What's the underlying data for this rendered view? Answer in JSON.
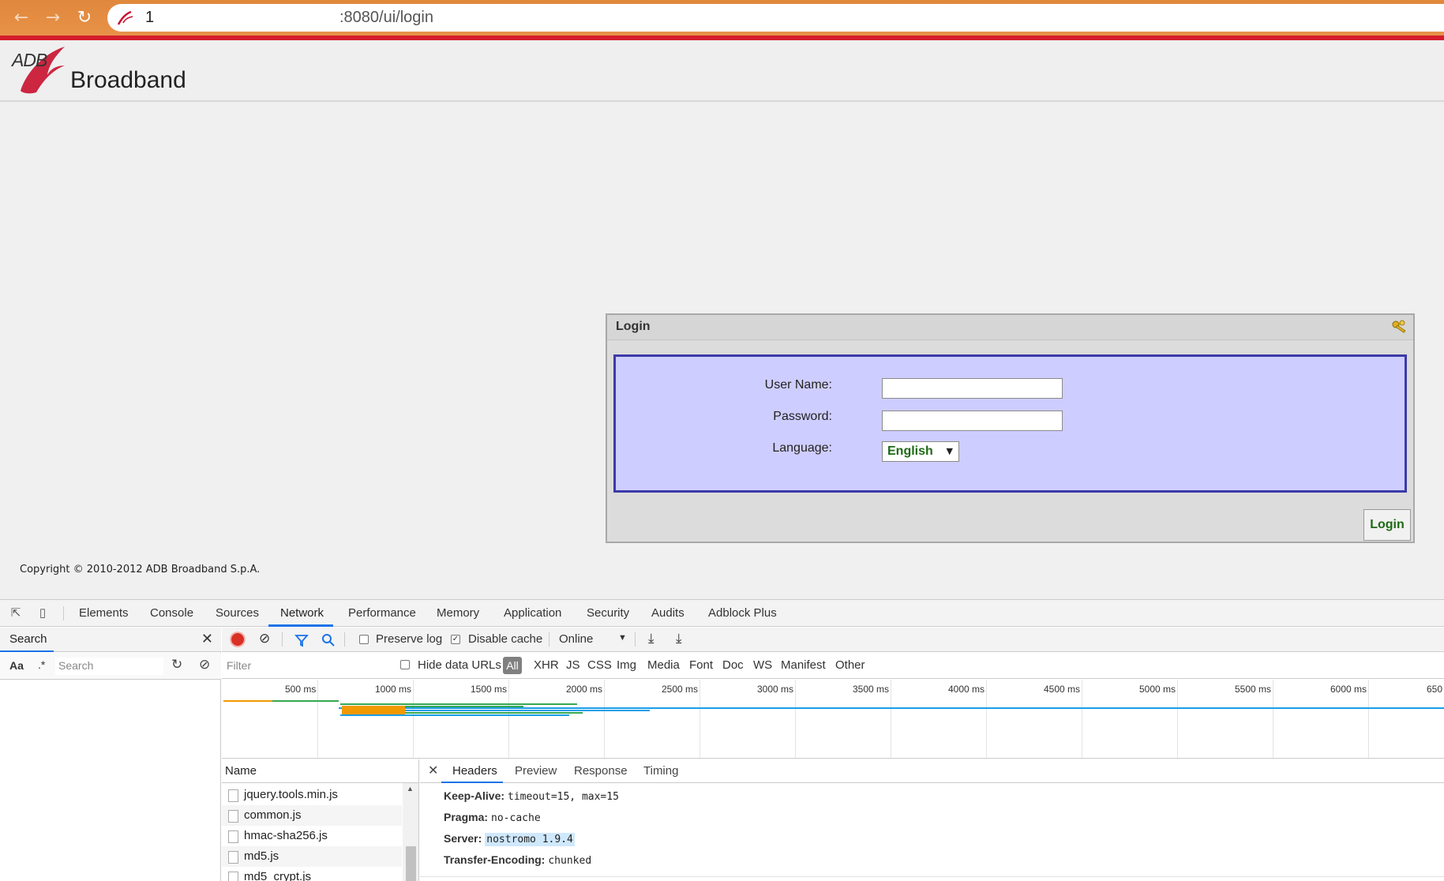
{
  "browser": {
    "url_prefix": "1",
    "url_text": ":8080/ui/login",
    "back_icon": "arrow-left-icon",
    "forward_icon": "arrow-right-icon",
    "reload_icon": "reload-icon"
  },
  "header": {
    "logo_adb": "ADB",
    "logo_broadband": "Broadband"
  },
  "login": {
    "title": "Login",
    "username_label": "User Name:",
    "password_label": "Password:",
    "language_label": "Language:",
    "language_value": "English",
    "username_value": "",
    "password_value": "",
    "login_button": "Login"
  },
  "footer": {
    "copyright": "Copyright © 2010-2012 ADB Broadband S.p.A."
  },
  "devtools": {
    "tabs": [
      "Elements",
      "Console",
      "Sources",
      "Network",
      "Performance",
      "Memory",
      "Application",
      "Security",
      "Audits",
      "Adblock Plus"
    ],
    "active_tab": "Network",
    "search": {
      "label": "Search",
      "aa": "Aa",
      "regex": ".*",
      "placeholder": "Search"
    },
    "toolbar": {
      "preserve_log": "Preserve log",
      "disable_cache": "Disable cache",
      "throttling": "Online"
    },
    "filter_bar": {
      "placeholder": "Filter",
      "hide_data_urls": "Hide data URLs",
      "types": [
        "All",
        "XHR",
        "JS",
        "CSS",
        "Img",
        "Media",
        "Font",
        "Doc",
        "WS",
        "Manifest",
        "Other"
      ]
    },
    "timeline_ticks": [
      "500 ms",
      "1000 ms",
      "1500 ms",
      "2000 ms",
      "2500 ms",
      "3000 ms",
      "3500 ms",
      "4000 ms",
      "4500 ms",
      "5000 ms",
      "5500 ms",
      "6000 ms",
      "650"
    ],
    "name_header": "Name",
    "files": [
      "jquery.tools.min.js",
      "common.js",
      "hmac-sha256.js",
      "md5.js",
      "md5_crypt.js"
    ],
    "detail_tabs": [
      "Headers",
      "Preview",
      "Response",
      "Timing"
    ],
    "headers": [
      {
        "key": "Keep-Alive:",
        "value": "timeout=15, max=15"
      },
      {
        "key": "Pragma:",
        "value": "no-cache"
      },
      {
        "key": "Server:",
        "value": "nostromo 1.9.4"
      },
      {
        "key": "Transfer-Encoding:",
        "value": "chunked"
      }
    ],
    "colors": {
      "accent": "#1a73e8",
      "record": "#d93025"
    }
  }
}
